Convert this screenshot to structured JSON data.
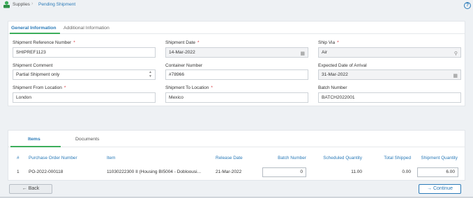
{
  "breadcrumb": {
    "parent": "Supplies",
    "current": "Pending Shipment"
  },
  "top_tabs": [
    "General Information",
    "Additional Information"
  ],
  "fields": {
    "ref_label": "Shipment Reference Number",
    "ref_value": "SHIPREF1123",
    "date_label": "Shipment Date",
    "date_value": "14-Mar-2022",
    "via_label": "Ship Via",
    "via_value": "Air",
    "comment_label": "Shipment Comment",
    "comment_value": "Partial Shipment only",
    "container_label": "Container Number",
    "container_value": "#78966",
    "arrival_label": "Expected Date of Arrival",
    "arrival_value": "31-Mar-2022",
    "from_label": "Shipment From Location",
    "from_value": "London",
    "to_label": "Shipment To Location",
    "to_value": "Mexico",
    "batch_label": "Batch Number",
    "batch_value": "BATCH2022001"
  },
  "required_mark": "*",
  "item_tabs": [
    "Items",
    "Documents"
  ],
  "table": {
    "headers": [
      "#",
      "Purchase Order Number",
      "Item",
      "Release Date",
      "Batch Number",
      "Scheduled Quantity",
      "Total Shipped",
      "Shipment Quantity"
    ],
    "rows": [
      {
        "num": "1",
        "po": "PO-2022-000118",
        "item": "11030222300 II (Housing BI5004 - Dobloousi...",
        "release": "21-Mar-2022",
        "batch": "0",
        "scheduled": "11.00",
        "shipped": "0.00",
        "qty": "6.00"
      }
    ]
  },
  "buttons": {
    "back": "Back",
    "continue": "Continue"
  },
  "icons": {
    "app": "supplies-app-icon",
    "help": "help-icon",
    "calendar": "calendar-icon",
    "search": "search-icon"
  },
  "colors": {
    "accent": "#2a7ab8",
    "tab_underline": "#3cae5b",
    "required": "#d9363e"
  }
}
